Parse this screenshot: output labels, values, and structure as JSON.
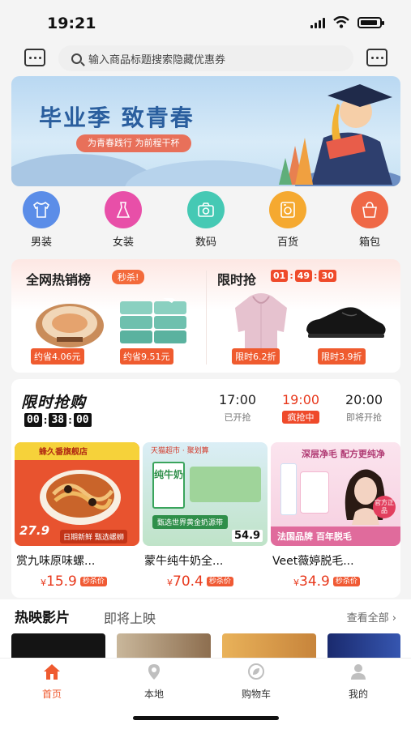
{
  "status": {
    "time": "19:21"
  },
  "search": {
    "placeholder": "输入商品标题搜索隐藏优惠券"
  },
  "banner": {
    "title": "毕业季 致青春",
    "subtitle": "为青春践行 为前程干杯"
  },
  "categories": [
    {
      "label": "男装",
      "color": "#5b8de8"
    },
    {
      "label": "女装",
      "color": "#e84fa8"
    },
    {
      "label": "数码",
      "color": "#45c9b4"
    },
    {
      "label": "百货",
      "color": "#f5a930"
    },
    {
      "label": "箱包",
      "color": "#ef6846"
    }
  ],
  "hot": {
    "title": "全网热销榜",
    "badge": "秒杀!",
    "items": [
      {
        "tag": "约省4.06元"
      },
      {
        "tag": "约省9.51元"
      }
    ]
  },
  "limited": {
    "title": "限时抢",
    "timer": [
      "01",
      "49",
      "30"
    ],
    "items": [
      {
        "tag": "限时6.2折"
      },
      {
        "tag": "限时3.9折"
      }
    ]
  },
  "flash_sale": {
    "title": "限时抢购",
    "countdown": [
      "00",
      "38",
      "00"
    ],
    "slots": [
      {
        "time": "17:00",
        "status": "已开抢",
        "active": false
      },
      {
        "time": "19:00",
        "status": "疯抢中",
        "active": true
      },
      {
        "time": "20:00",
        "status": "即将开抢",
        "active": false
      }
    ],
    "products": [
      {
        "name": "赏九味原味螺...",
        "currency": "¥",
        "price": "15.9",
        "tag": "秒杀价",
        "img_store": "蜂久番旗舰店",
        "img_price": "27.9",
        "img_banner": "日期新鲜 甄选螺蛳"
      },
      {
        "name": "蒙牛纯牛奶全...",
        "currency": "¥",
        "price": "70.4",
        "tag": "秒杀价",
        "img_store": "天猫超市 · 聚划算",
        "img_product": "纯牛奶",
        "img_price": "54.9",
        "img_banner": "甄选世界黄金奶源带"
      },
      {
        "name": "Veet薇婷脱毛...",
        "currency": "¥",
        "price": "34.9",
        "tag": "秒杀价",
        "img_headline": "深层净毛 配方更纯净",
        "img_banner": "法国品牌 百年脱毛",
        "img_badge": "官方正品"
      }
    ]
  },
  "movies": {
    "title": "热映影片",
    "tab": "即将上映",
    "see_all": "查看全部 ›"
  },
  "tabbar": [
    {
      "label": "首页",
      "active": true
    },
    {
      "label": "本地",
      "active": false
    },
    {
      "label": "购物车",
      "active": false
    },
    {
      "label": "我的",
      "active": false
    }
  ],
  "colors": {
    "accent": "#ef4a2a",
    "price": "#e8391d",
    "banner_title": "#2a5e9e"
  }
}
